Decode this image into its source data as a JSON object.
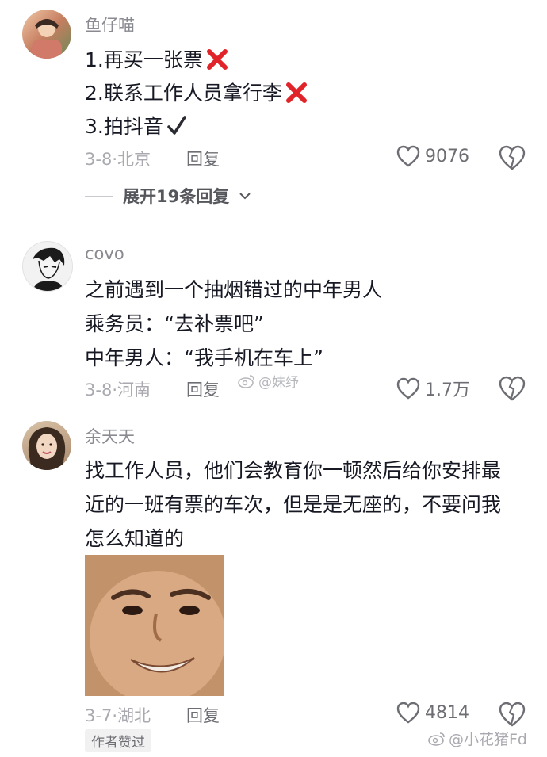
{
  "comments": [
    {
      "username": "鱼仔喵",
      "lines": [
        "1.再买一张票",
        "2.联系工作人员拿行李",
        "3.拍抖音"
      ],
      "date": "3-8",
      "location": "北京",
      "reply_label": "回复",
      "likes": "9076",
      "expand_label": "展开19条回复"
    },
    {
      "username": "covo",
      "lines": [
        "之前遇到一个抽烟错过的中年男人",
        "乘务员：“去补票吧”",
        "中年男人：“我手机在车上”"
      ],
      "date": "3-8",
      "location": "河南",
      "reply_label": "回复",
      "likes": "1.7万"
    },
    {
      "username": "余天天",
      "lines": [
        "找工作人员，他们会教育你一顿然后给你安排最",
        "近的一班有票的车次，但是是无座的，不要问我",
        "怎么知道的"
      ],
      "date": "3-7",
      "location": "湖北",
      "reply_label": "回复",
      "likes": "4814",
      "badge": "作者赞过"
    }
  ],
  "watermarks": {
    "center": "@妹纾",
    "corner": "@小花猪Fd"
  },
  "icons": [
    "red-x-icon",
    "checkmark-icon",
    "heart-icon",
    "broken-heart-icon",
    "chevron-down-icon",
    "weibo-icon"
  ],
  "colors": {
    "cross": "#e0242a",
    "text": "#161823",
    "muted": "#a9aab0"
  }
}
